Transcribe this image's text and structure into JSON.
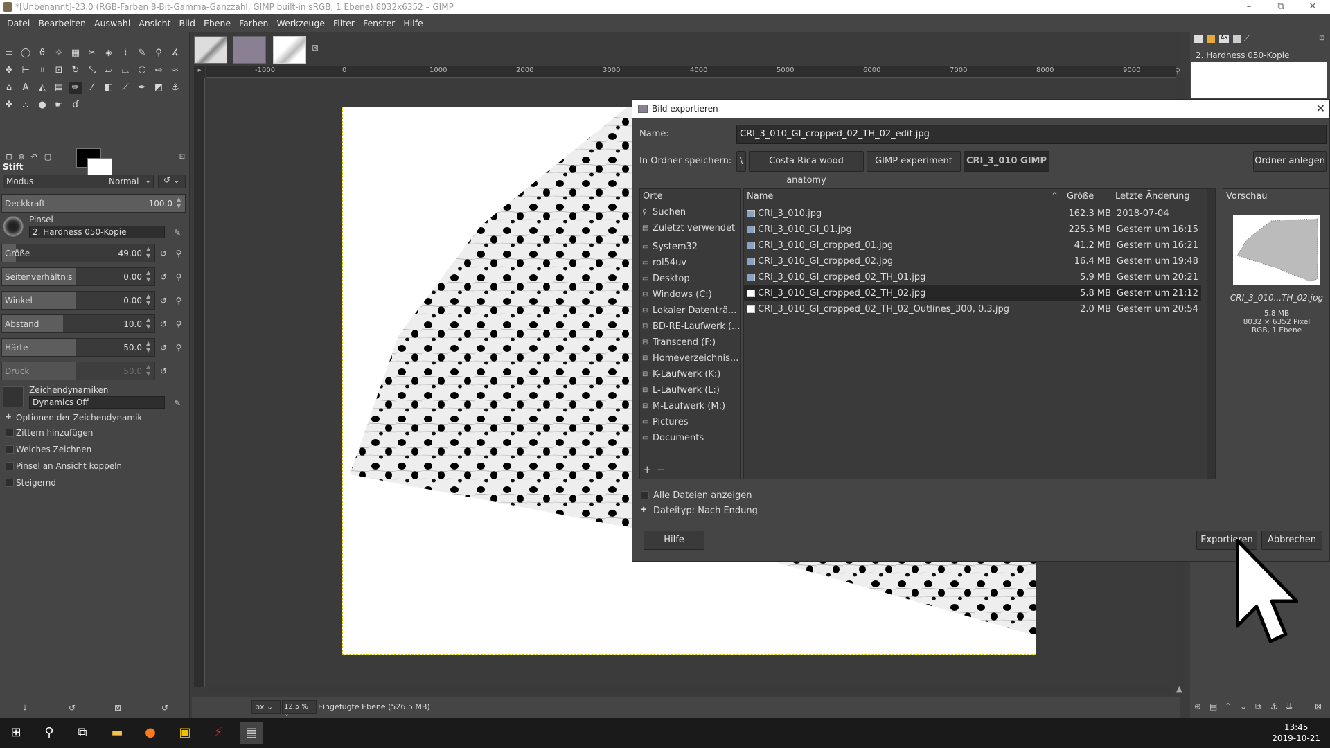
{
  "window": {
    "title": "*[Unbenannt]-23.0 (RGB-Farben 8-Bit-Gamma-Ganzzahl, GIMP built-in sRGB, 1 Ebene) 8032x6352 – GIMP",
    "minimize": "–",
    "maximize": "⧉",
    "close": "✕"
  },
  "menu": [
    "Datei",
    "Bearbeiten",
    "Auswahl",
    "Ansicht",
    "Bild",
    "Ebene",
    "Farben",
    "Werkzeuge",
    "Filter",
    "Fenster",
    "Hilfe"
  ],
  "toolbox": {
    "tool_name": "Stift",
    "mode_label": "Modus",
    "mode_value": "Normal",
    "opacity_label": "Deckkraft",
    "opacity_value": "100.0",
    "brush_label": "Pinsel",
    "brush_value": "2. Hardness 050-Kopie",
    "size_label": "Größe",
    "size_value": "49.00",
    "aspect_label": "Seitenverhältnis",
    "aspect_value": "0.00",
    "angle_label": "Winkel",
    "angle_value": "0.00",
    "spacing_label": "Abstand",
    "spacing_value": "10.0",
    "hardness_label": "Härte",
    "hardness_value": "50.0",
    "pressure_label": "Druck",
    "pressure_value": "50.0",
    "dynamics_label": "Zeichendynamiken",
    "dynamics_value": "Dynamics Off",
    "dyn_options": "Optionen der Zeichendynamik",
    "jitter": "Zittern hinzufügen",
    "smooth": "Weiches Zeichnen",
    "lock_view": "Pinsel an Ansicht koppeln",
    "incremental": "Steigernd"
  },
  "ruler_labels": [
    "-1000",
    "0",
    "1000",
    "2000",
    "3000",
    "4000",
    "5000",
    "6000",
    "7000",
    "8000",
    "9000"
  ],
  "status": {
    "unit": "px",
    "zoom": "12.5 %",
    "message": "Eingefügte Ebene (526.5 MB)"
  },
  "layers": {
    "active_layer": "2. Hardness 050-Kopie"
  },
  "dialog": {
    "title": "Bild exportieren",
    "name_label": "Name:",
    "name_value": "CRI_3_010_GI_cropped_02_TH_02_edit.jpg",
    "folder_label": "In Ordner speichern:",
    "crumbs": [
      "\\",
      "Costa Rica wood anatomy",
      "GIMP experiment",
      "CRI_3_010 GIMP"
    ],
    "create_folder": "Ordner anlegen",
    "places_header": "Orte",
    "places": [
      {
        "label": "Suchen",
        "icon": "search-icon"
      },
      {
        "label": "Zuletzt verwendet",
        "icon": "recent-icon"
      },
      {
        "label": "System32",
        "icon": "folder-icon"
      },
      {
        "label": "rol54uv",
        "icon": "folder-icon"
      },
      {
        "label": "Desktop",
        "icon": "folder-icon"
      },
      {
        "label": "Windows (C:)",
        "icon": "drive-icon"
      },
      {
        "label": "Lokaler Datenträ...",
        "icon": "drive-icon"
      },
      {
        "label": "BD-RE-Laufwerk (...",
        "icon": "drive-icon"
      },
      {
        "label": "Transcend (F:)",
        "icon": "drive-icon"
      },
      {
        "label": "Homeverzeichnis...",
        "icon": "drive-icon"
      },
      {
        "label": "K-Laufwerk (K:)",
        "icon": "drive-icon"
      },
      {
        "label": "L-Laufwerk (L:)",
        "icon": "drive-icon"
      },
      {
        "label": "M-Laufwerk (M:)",
        "icon": "drive-icon"
      },
      {
        "label": "Pictures",
        "icon": "folder-icon"
      },
      {
        "label": "Documents",
        "icon": "folder-icon"
      }
    ],
    "col_name": "Name",
    "col_size": "Größe",
    "col_date": "Letzte Änderung",
    "files": [
      {
        "name": "CRI_3_010.jpg",
        "size": "162.3 MB",
        "date": "2018-07-04"
      },
      {
        "name": "CRI_3_010_GI_01.jpg",
        "size": "225.5 MB",
        "date": "Gestern um 16:15"
      },
      {
        "name": "CRI_3_010_GI_cropped_01.jpg",
        "size": "41.2 MB",
        "date": "Gestern um 16:21"
      },
      {
        "name": "CRI_3_010_GI_cropped_02.jpg",
        "size": "16.4 MB",
        "date": "Gestern um 19:48"
      },
      {
        "name": "CRI_3_010_GI_cropped_02_TH_01.jpg",
        "size": "5.9 MB",
        "date": "Gestern um 20:21"
      },
      {
        "name": "CRI_3_010_GI_cropped_02_TH_02.jpg",
        "size": "5.8 MB",
        "date": "Gestern um 21:12"
      },
      {
        "name": "CRI_3_010_GI_cropped_02_TH_02_Outlines_300, 0.3.jpg",
        "size": "2.0 MB",
        "date": "Gestern um 20:54"
      }
    ],
    "selected_file_index": 5,
    "preview_header": "Vorschau",
    "preview_name": "CRI_3_010...TH_02.jpg",
    "preview_size": "5.8 MB",
    "preview_dims": "8032 × 6352 Pixel",
    "preview_mode": "RGB, 1 Ebene",
    "show_all": "Alle Dateien anzeigen",
    "filetype": "Dateityp: Nach Endung",
    "help": "Hilfe",
    "export": "Exportieren",
    "cancel": "Abbrechen",
    "add_place": "+",
    "remove_place": "−"
  },
  "taskbar": {
    "time": "13:45",
    "date": "2019-10-21"
  }
}
